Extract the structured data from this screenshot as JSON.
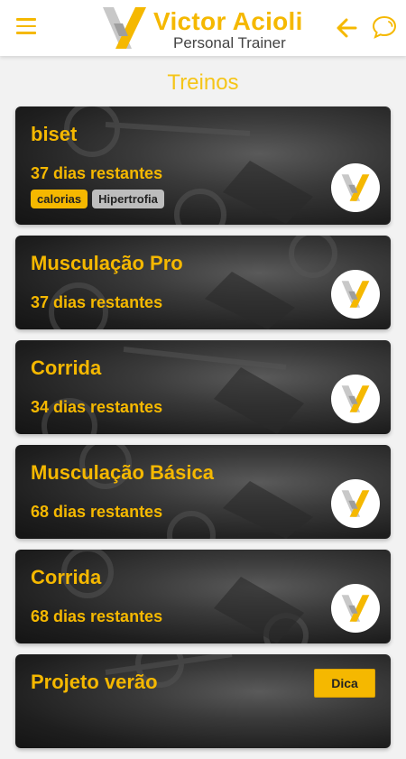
{
  "header": {
    "brand_name": "Victor Acioli",
    "brand_subtitle": "Personal Trainer",
    "menu_icon": "hamburger-menu-icon",
    "back_icon": "arrow-left-icon",
    "chat_icon": "chat-bubble-icon",
    "accent_color": "#f5b800"
  },
  "page": {
    "title": "Treinos"
  },
  "workouts": [
    {
      "title": "biset",
      "days": "37 dias restantes",
      "tags": [
        "calorias",
        "Hipertrofia"
      ]
    },
    {
      "title": "Musculação Pro",
      "days": "37 dias restantes"
    },
    {
      "title": "Corrida",
      "days": "34 dias restantes"
    },
    {
      "title": "Musculação Básica",
      "days": "68 dias restantes"
    },
    {
      "title": "Corrida",
      "days": "68 dias restantes"
    },
    {
      "title": "Projeto verão",
      "badge": "Dica"
    }
  ]
}
